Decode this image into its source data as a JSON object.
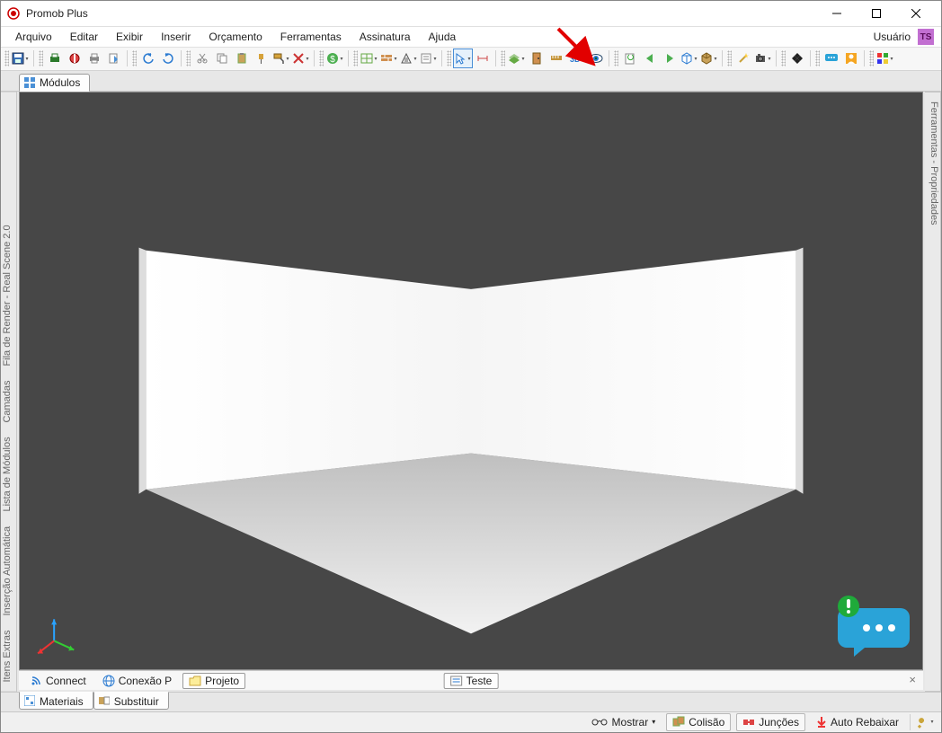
{
  "app": {
    "title": "Promob Plus"
  },
  "menu": {
    "items": [
      "Arquivo",
      "Editar",
      "Exibir",
      "Inserir",
      "Orçamento",
      "Ferramentas",
      "Assinatura",
      "Ajuda"
    ],
    "user_label": "Usuário",
    "user_initials": "TS"
  },
  "toolbar": {
    "icons": [
      "save",
      "print",
      "globe",
      "printer2",
      "export",
      "undo",
      "redo",
      "cut",
      "copy",
      "paste",
      "brush",
      "paint",
      "erase",
      "money",
      "layout",
      "wall",
      "panel",
      "list",
      "cursor",
      "ruler",
      "layers",
      "door",
      "dim",
      "3d",
      "eye",
      "page",
      "back",
      "forward",
      "book",
      "box",
      "wand",
      "camera",
      "grid",
      "chat",
      "person",
      "palette"
    ]
  },
  "tabs": {
    "top": "Módulos",
    "bottom_left": [
      "Materiais",
      "Substituir"
    ]
  },
  "side_left": [
    "Itens Extras",
    "Inserção Automática",
    "Lista de Módulos",
    "Camadas",
    "Fila de Render - Real Scene 2.0"
  ],
  "side_right": [
    "Ferramentas - Propriedades"
  ],
  "connect": {
    "connect_label": "Connect",
    "conexao_label": "Conexão P",
    "projeto_label": "Projeto",
    "teste_label": "Teste"
  },
  "status": {
    "mostrar": "Mostrar",
    "colisao": "Colisão",
    "juncoes": "Junções",
    "auto_rebaixar": "Auto Rebaixar"
  }
}
